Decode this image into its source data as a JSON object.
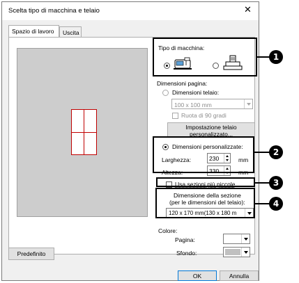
{
  "dialog": {
    "title": "Scelta tipo di macchina e telaio",
    "close_icon": "close-icon"
  },
  "tabs": [
    {
      "label": "Spazio di lavoro",
      "active": true
    },
    {
      "label": "Uscita",
      "active": false
    }
  ],
  "machine_type": {
    "label": "Tipo di macchina:",
    "options": [
      {
        "icon": "embroidery-machine-icon",
        "selected": true
      },
      {
        "icon": "multi-needle-machine-icon",
        "selected": false
      }
    ]
  },
  "page_size": {
    "label": "Dimensioni pagina:",
    "hoop_size_label": "Dimensioni telaio:",
    "hoop_size_value": "100 x 100 mm",
    "rotate_label": "Ruota di 90 gradi",
    "custom_hoop_button_line1": "Impostazione telaio",
    "custom_hoop_button_line2": "personalizzato...",
    "custom_size_label": "Dimensioni personalizzate:",
    "width_label": "Larghezza:",
    "width_value": "230",
    "height_label": "Altezza:",
    "height_value": "330",
    "unit": "mm"
  },
  "sections": {
    "smaller_sections_label": "Usa sezioni più piccole",
    "section_size_line1": "Dimensione della sezione",
    "section_size_line2": "(per le dimensioni del telaio):",
    "section_size_value": "120 x 170 mm(130 x 180 m"
  },
  "colors": {
    "label": "Colore:",
    "page_label": "Pagina:",
    "background_label": "Sfondo:",
    "page_color": "#ffffff",
    "background_color": "#c0c0c0"
  },
  "buttons": {
    "default": "Predefinito",
    "ok": "OK",
    "cancel": "Annulla"
  },
  "callouts": [
    "1",
    "2",
    "3",
    "4"
  ]
}
